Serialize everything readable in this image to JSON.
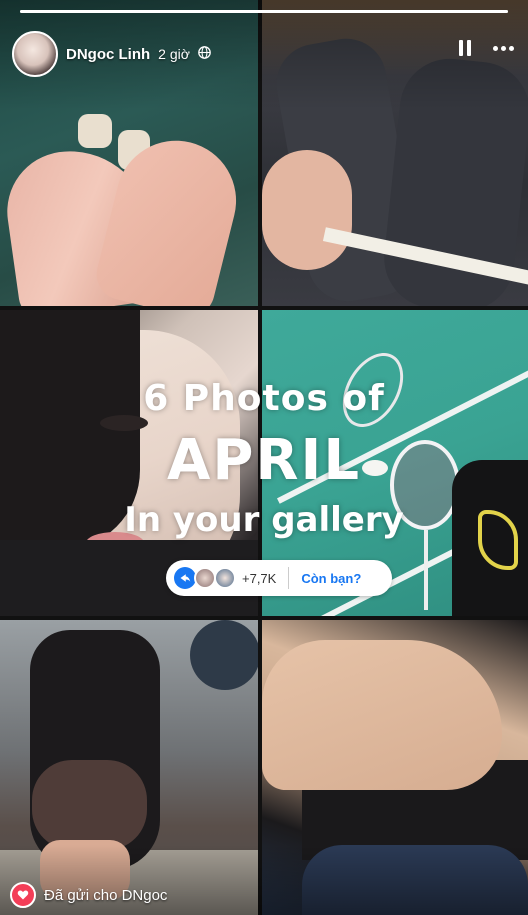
{
  "story": {
    "author_name": "DNgoc Linh",
    "time_ago": "2 giờ",
    "privacy_icon": "globe-icon",
    "pause_icon": "pause-icon",
    "more_icon": "more-options-icon",
    "progress": 1.0
  },
  "overlay": {
    "line1": "6 Photos of",
    "line2": "APRIL",
    "line3": "In your gallery"
  },
  "reactions": {
    "share_icon": "share-arrow-icon",
    "count": "+7,7K",
    "cta": "Còn bạn?"
  },
  "footer": {
    "sent_text": "Đã gửi cho DNgoc",
    "reaction_icon": "heart-icon"
  },
  "colors": {
    "accent": "#1877f2",
    "heart": "#f33e58"
  }
}
